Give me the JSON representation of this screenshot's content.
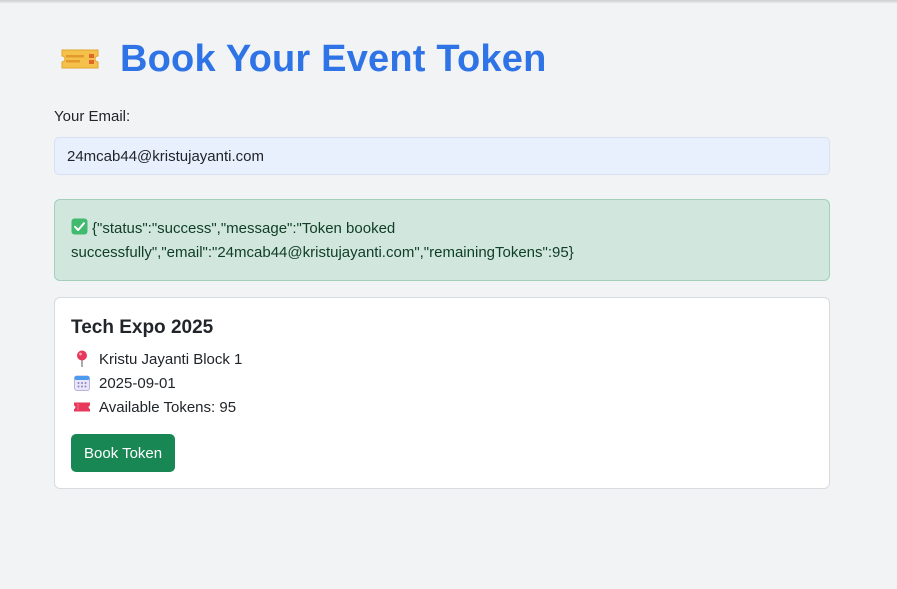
{
  "header": {
    "title": "Book Your Event Token",
    "icon": "ticket-icon"
  },
  "form": {
    "email_label": "Your Email:",
    "email_value": "24mcab44@kristujayanti.com"
  },
  "alert": {
    "icon": "check-mark-icon",
    "message": "{\"status\":\"success\",\"message\":\"Token booked successfully\",\"email\":\"24mcab44@kristujayanti.com\",\"remainingTokens\":95}"
  },
  "event": {
    "title": "Tech Expo 2025",
    "location": "Kristu Jayanti Block 1",
    "date": "2025-09-01",
    "tokens": "Available Tokens: 95",
    "book_label": "Book Token"
  },
  "colors": {
    "title": "#2f74e6",
    "success_bg": "#d1e7dd",
    "button": "#198754",
    "background": "#f2f3f5"
  }
}
